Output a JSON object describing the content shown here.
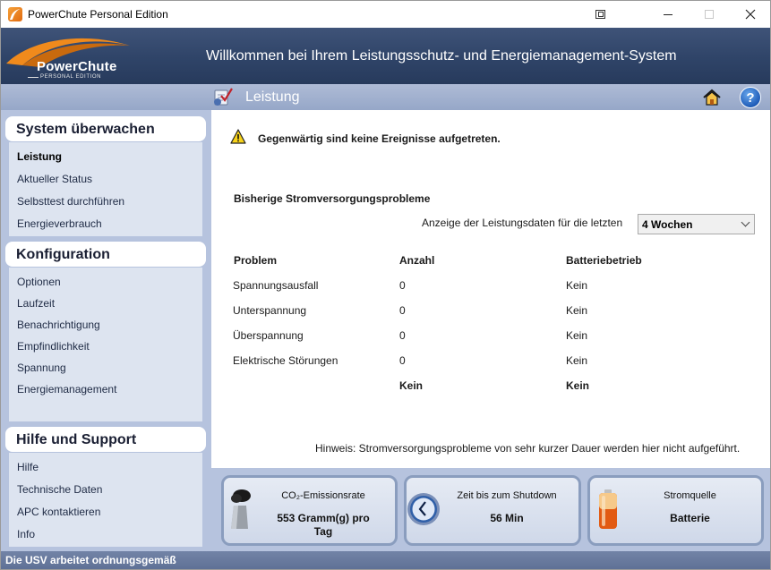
{
  "window": {
    "title": "PowerChute Personal Edition"
  },
  "banner": {
    "logo_text": "PowerChute",
    "logo_sub": "PERSONAL EDITION",
    "welcome": "Willkommen bei Ihrem Leistungsschutz- und Energiemanagement-System"
  },
  "section": {
    "title": "Leistung"
  },
  "sidebar": {
    "groups": [
      {
        "heading": "System überwachen",
        "items": [
          "Leistung",
          "Aktueller Status",
          "Selbsttest durchführen",
          "Energieverbrauch"
        ]
      },
      {
        "heading": "Konfiguration",
        "items": [
          "Optionen",
          "Laufzeit",
          "Benachrichtigung",
          "Empfindlichkeit",
          "Spannung",
          "Energiemanagement"
        ]
      },
      {
        "heading": "Hilfe und Support",
        "items": [
          "Hilfe",
          "Technische Daten",
          "APC kontaktieren",
          "Info"
        ]
      }
    ],
    "active_item": "Leistung"
  },
  "main": {
    "alert": "Gegenwärtig sind keine Ereignisse aufgetreten.",
    "history_title": "Bisherige Stromversorgungsprobleme",
    "period_label": "Anzeige der Leistungsdaten für die letzten",
    "period_value": "4 Wochen",
    "table": {
      "headers": [
        "Problem",
        "Anzahl",
        "Batteriebetrieb"
      ],
      "rows": [
        [
          "Spannungsausfall",
          "0",
          "Kein"
        ],
        [
          "Unterspannung",
          "0",
          "Kein"
        ],
        [
          "Überspannung",
          "0",
          "Kein"
        ],
        [
          "Elektrische Störungen",
          "0",
          "Kein"
        ]
      ],
      "totals": [
        "",
        "Kein",
        "Kein"
      ]
    },
    "note": "Hinweis: Stromversorgungsprobleme von sehr kurzer Dauer werden hier nicht aufgeführt."
  },
  "tiles": [
    {
      "label": "CO₂-Emissionsrate",
      "value_line1": "553 Gramm(g) pro",
      "value_line2": "Tag",
      "icon": "factory-icon"
    },
    {
      "label": "Zeit bis zum Shutdown",
      "value_line1": "56 Min",
      "value_line2": "",
      "icon": "clock-icon"
    },
    {
      "label": "Stromquelle",
      "value_line1": "Batterie",
      "value_line2": "",
      "icon": "battery-icon"
    }
  ],
  "status": {
    "text": "Die USV arbeitet ordnungsgemäß"
  },
  "colors": {
    "banner": "#2f4468",
    "sidebar": "#b6c3de",
    "accent_orange": "#f08a1c"
  }
}
